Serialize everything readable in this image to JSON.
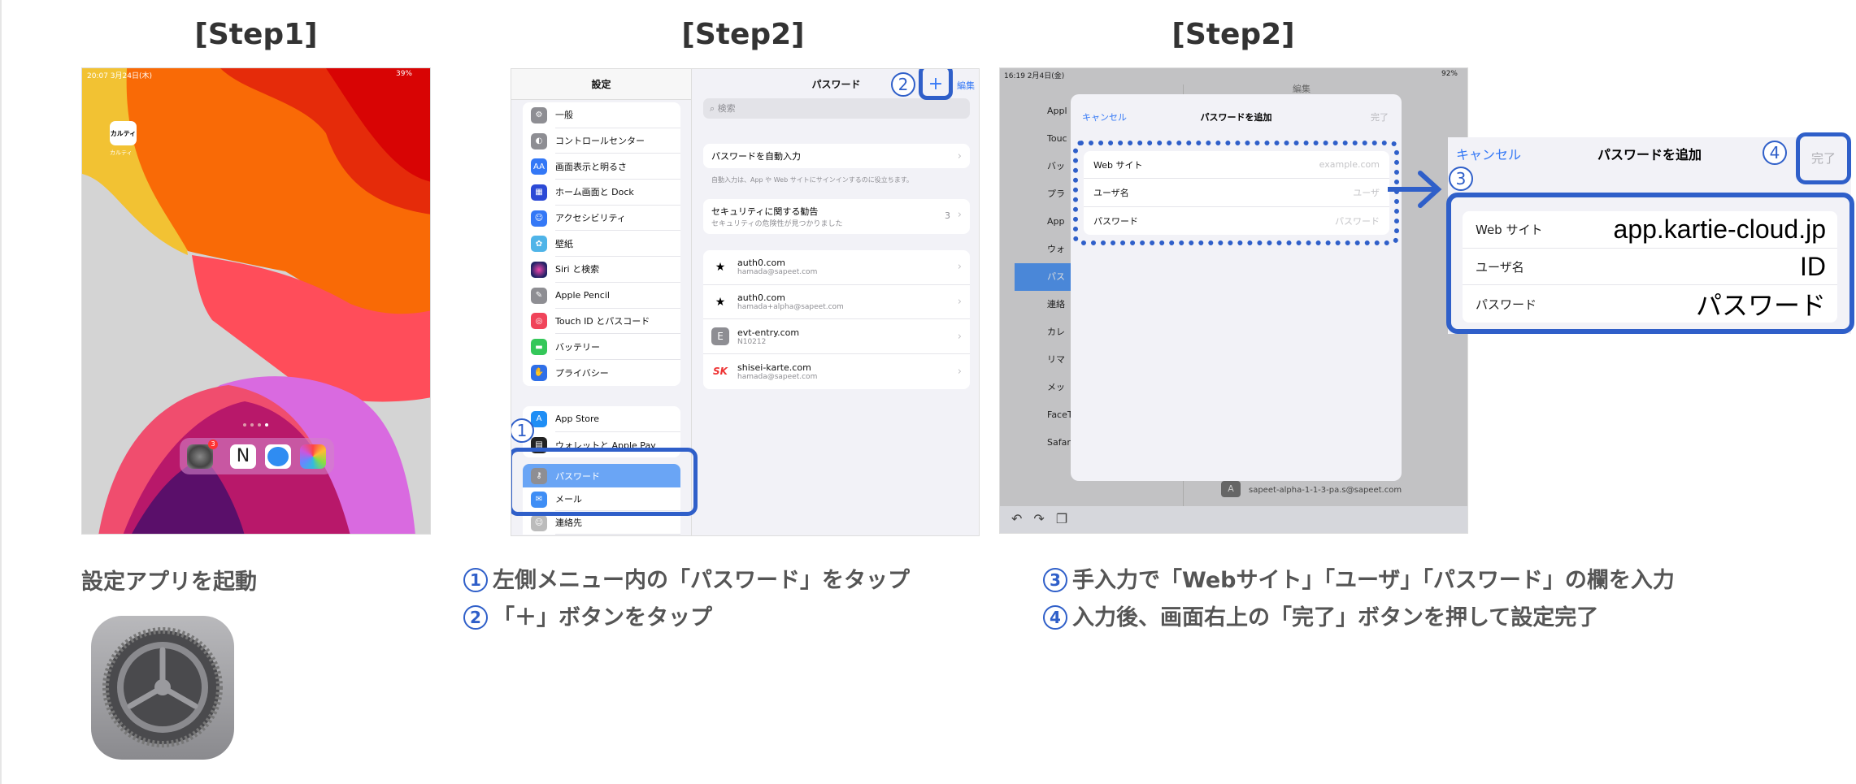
{
  "titles": [
    "[Step1]",
    "[Step2]",
    "[Step2]"
  ],
  "colors": {
    "accent": "#2f5fc9",
    "ios_blue": "#3478f6",
    "caption": "#555555"
  },
  "step1": {
    "status_time": "20:07  3月24日(木)",
    "status_battery": "39%",
    "app_icon_text": "カルティ",
    "app_label": "カルティ",
    "dock_badge": "3",
    "dock_apps": [
      "settings-icon",
      "notion-icon",
      "safari-icon",
      "photos-icon"
    ],
    "caption": "設定アプリを起動"
  },
  "step2": {
    "left_title": "設定",
    "group1": [
      "一般",
      "コントロールセンター",
      "画面表示と明るさ",
      "ホーム画面と Dock",
      "アクセシビリティ",
      "壁紙",
      "Siri と検索",
      "Apple Pencil",
      "Touch ID とパスコード",
      "バッテリー",
      "プライバシー"
    ],
    "group2": [
      "App Store",
      "ウォレットと Apple Pay"
    ],
    "group3": [
      "パスワード",
      "メール",
      "連絡先"
    ],
    "right_title": "パスワード",
    "edit": "編集",
    "search_placeholder": "検索",
    "autofill": "パスワードを自動入力",
    "autofill_note": "自動入力は、App や Web サイトにサインインするのに役立ちます。",
    "security_title": "セキュリティに関する勧告",
    "security_sub": "セキュリティの危険性が見つかりました",
    "security_count": "3",
    "accounts": [
      {
        "site": "auth0.com",
        "user": "hamada@sapeet.com",
        "icon": "auth0-icon"
      },
      {
        "site": "auth0.com",
        "user": "hamada+alpha@sapeet.com",
        "icon": "auth0-icon"
      },
      {
        "site": "evt-entry.com",
        "user": "N10212",
        "icon": "E"
      },
      {
        "site": "shisei-karte.com",
        "user": "hamada@sapeet.com",
        "icon": "SK"
      }
    ],
    "mark1": "1",
    "mark2": "2",
    "captions": [
      "左側メニュー内の「パスワード」をタップ",
      "「＋」ボタンをタップ"
    ],
    "caption_nums": [
      "①",
      "②"
    ]
  },
  "step3": {
    "status_time": "16:19  2月4日(金)",
    "status_battery": "92%",
    "bg_sidebar": [
      "Appl",
      "Touc",
      "バッ",
      "プラ",
      "App",
      "ウォ",
      "パス",
      "連絡",
      "カレ",
      "リマ",
      "メッ",
      "FaceTime",
      "Safari"
    ],
    "bg_account": "sapeet-alpha-1-1-3-pa.s@sapeet.com",
    "bg_edit": "編集",
    "modal": {
      "cancel": "キャンセル",
      "title": "パスワードを追加",
      "done": "完了",
      "fields": [
        {
          "label": "Web サイト",
          "placeholder": "example.com"
        },
        {
          "label": "ユーザ名",
          "placeholder": "ユーザ"
        },
        {
          "label": "パスワード",
          "placeholder": "パスワード"
        }
      ]
    },
    "popup": {
      "cancel": "キャンセル",
      "title": "パスワードを追加",
      "done": "完了",
      "fields": [
        {
          "label": "Web サイト",
          "value": "app.kartie-cloud.jp"
        },
        {
          "label": "ユーザ名",
          "value": "ID"
        },
        {
          "label": "パスワード",
          "value": "パスワード"
        }
      ]
    },
    "mark3": "3",
    "mark4": "4",
    "captions": [
      "手入力で「Webサイト」「ユーザ」「パスワード」の欄を入力",
      "入力後、画面右上の「完了」ボタンを押して設定完了"
    ],
    "caption_nums": [
      "③",
      "④"
    ]
  }
}
